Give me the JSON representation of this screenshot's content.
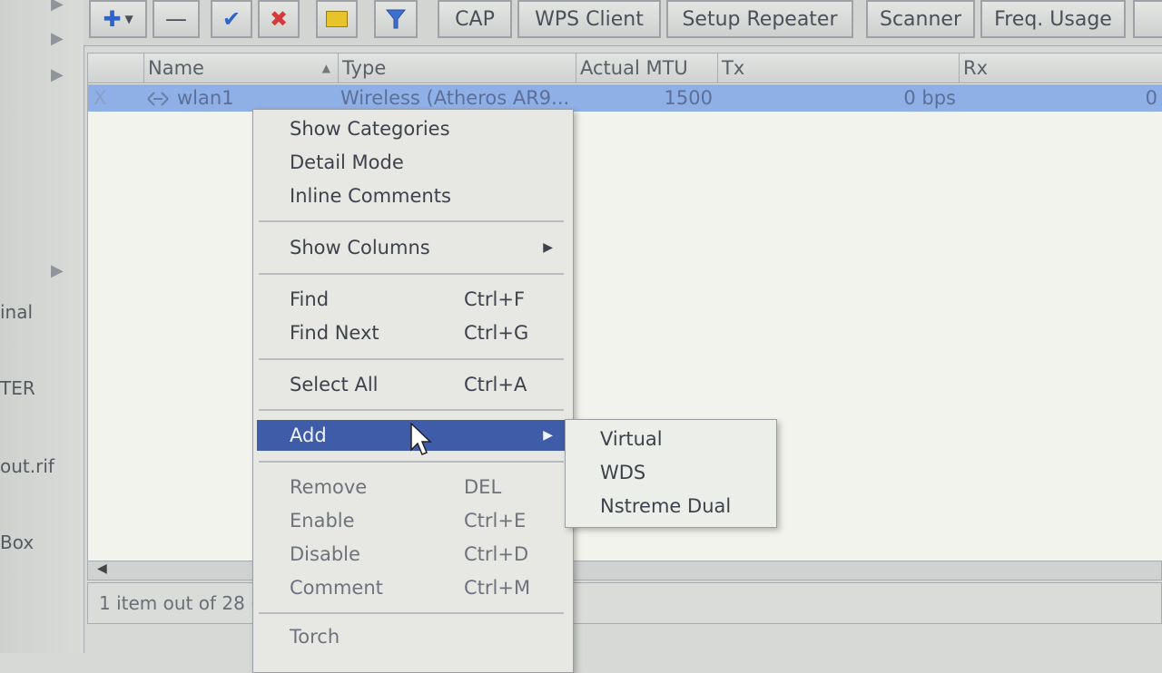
{
  "sidebar": {
    "labels": [
      "inal",
      "TER",
      "out.rif",
      "Box"
    ]
  },
  "toolbar": {
    "buttons": [
      "CAP",
      "WPS Client",
      "Setup Repeater",
      "Scanner",
      "Freq. Usage"
    ]
  },
  "table": {
    "headers": [
      "Name",
      "Type",
      "Actual MTU",
      "Tx",
      "Rx"
    ],
    "row": {
      "flag": "X",
      "name": "wlan1",
      "type": "Wireless (Atheros AR9...",
      "mtu": "1500",
      "tx": "0 bps",
      "rx": "0"
    }
  },
  "status": {
    "text": "1 item out of 28 ("
  },
  "context_menu": {
    "show_categories": "Show Categories",
    "detail_mode": "Detail Mode",
    "inline_comments": "Inline Comments",
    "show_columns": "Show Columns",
    "find": "Find",
    "find_shortcut": "Ctrl+F",
    "find_next": "Find Next",
    "find_next_shortcut": "Ctrl+G",
    "select_all": "Select All",
    "select_all_shortcut": "Ctrl+A",
    "add": "Add",
    "remove": "Remove",
    "remove_shortcut": "DEL",
    "enable": "Enable",
    "enable_shortcut": "Ctrl+E",
    "disable": "Disable",
    "disable_shortcut": "Ctrl+D",
    "comment": "Comment",
    "comment_shortcut": "Ctrl+M",
    "torch": "Torch"
  },
  "add_submenu": [
    "Virtual",
    "WDS",
    "Nstreme Dual"
  ],
  "colors": {
    "highlight": "#3f5ca8",
    "selected_row": "#8fb0e6",
    "remove_icon": "#d63a3a",
    "add_icon": "#2e63c9"
  }
}
